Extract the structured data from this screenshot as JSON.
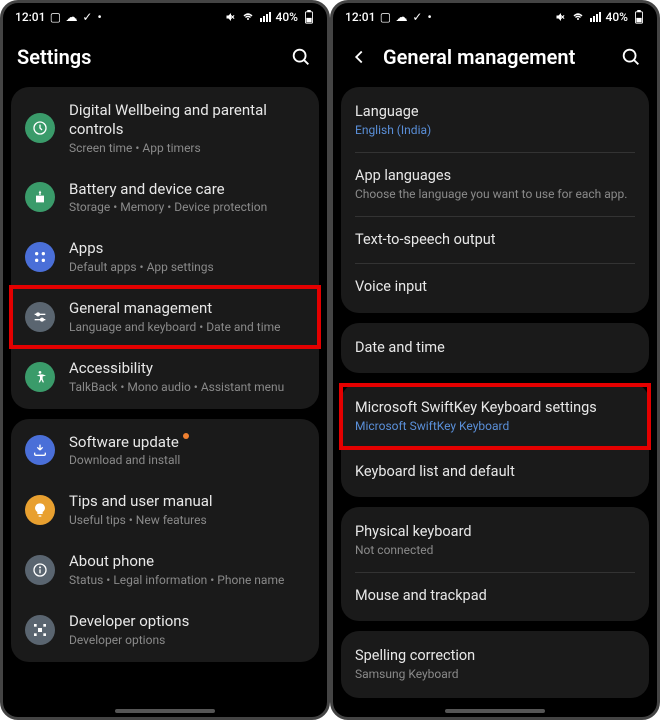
{
  "status": {
    "time": "12:01",
    "battery": "40%"
  },
  "left": {
    "title": "Settings",
    "groups": [
      {
        "items": [
          {
            "title": "Digital Wellbeing and parental controls",
            "sub": "Screen time  •  App timers",
            "icon": "wellbeing",
            "color": "#3a9b6a"
          },
          {
            "title": "Battery and device care",
            "sub": "Storage  •  Memory  •  Device protection",
            "icon": "battery",
            "color": "#3a9b6a"
          },
          {
            "title": "Apps",
            "sub": "Default apps  •  App settings",
            "icon": "apps",
            "color": "#4a6fd8"
          },
          {
            "title": "General management",
            "sub": "Language and keyboard  •  Date and time",
            "icon": "general",
            "color": "#5a6570",
            "highlight": true
          },
          {
            "title": "Accessibility",
            "sub": "TalkBack  •  Mono audio  •  Assistant menu",
            "icon": "accessibility",
            "color": "#3a9b6a"
          }
        ]
      },
      {
        "items": [
          {
            "title": "Software update",
            "sub": "Download and install",
            "icon": "update",
            "color": "#4a6fd8",
            "badge": true
          },
          {
            "title": "Tips and user manual",
            "sub": "Useful tips  •  New features",
            "icon": "tips",
            "color": "#e8a030"
          },
          {
            "title": "About phone",
            "sub": "Status  •  Legal information  •  Phone name",
            "icon": "about",
            "color": "#5a6570"
          },
          {
            "title": "Developer options",
            "sub": "Developer options",
            "icon": "dev",
            "color": "#5a6570"
          }
        ]
      }
    ]
  },
  "right": {
    "title": "General management",
    "groups": [
      {
        "items": [
          {
            "title": "Language",
            "sub": "English (India)",
            "subBlue": true
          },
          {
            "title": "App languages",
            "sub": "Choose the language you want to use for each app."
          },
          {
            "title": "Text-to-speech output"
          },
          {
            "title": "Voice input"
          }
        ]
      },
      {
        "items": [
          {
            "title": "Date and time"
          }
        ]
      },
      {
        "items": [
          {
            "title": "Microsoft SwiftKey Keyboard settings",
            "sub": "Microsoft SwiftKey Keyboard",
            "subBlue": true,
            "highlight": true
          },
          {
            "title": "Keyboard list and default"
          }
        ]
      },
      {
        "items": [
          {
            "title": "Physical keyboard",
            "sub": "Not connected"
          },
          {
            "title": "Mouse and trackpad"
          }
        ]
      },
      {
        "items": [
          {
            "title": "Spelling correction",
            "sub": "Samsung Keyboard"
          }
        ]
      }
    ]
  }
}
